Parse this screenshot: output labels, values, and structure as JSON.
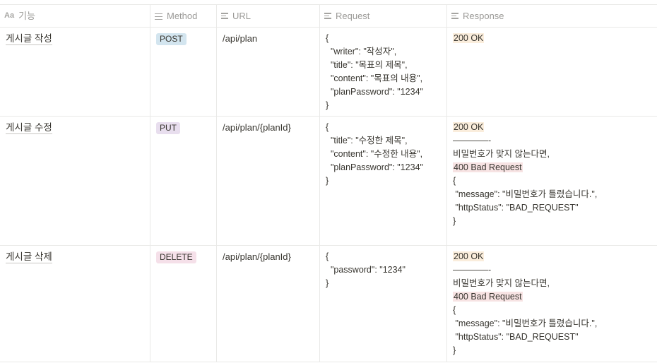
{
  "columns": {
    "feature": {
      "icon": "Aa",
      "label": "기능"
    },
    "method": {
      "icon": "list-icon",
      "label": "Method"
    },
    "url": {
      "icon": "text-icon",
      "label": "URL"
    },
    "request": {
      "icon": "text-icon",
      "label": "Request"
    },
    "response": {
      "icon": "text-icon",
      "label": "Response"
    }
  },
  "rows": [
    {
      "feature": "게시글 작성",
      "method": "POST",
      "url": "/api/plan",
      "request": "{\n  \"writer\": \"작성자\",\n  \"title\": \"목표의 제목\",\n  \"content\": \"목표의 내용\",\n  \"planPassword\": \"1234\"\n}",
      "response": {
        "status_ok": "200 OK"
      }
    },
    {
      "feature": "게시글 수정",
      "method": "PUT",
      "url": "/api/plan/{planId}",
      "request": "{\n  \"title\": \"수정한 제목\",\n  \"content\": \"수정한 내용\",\n  \"planPassword\": \"1234\"\n}",
      "response": {
        "status_ok": "200 OK",
        "divider": "————-",
        "condition": "비밀번호가 맞지 않는다면,",
        "status_bad": "400 Bad Request",
        "body": "{\n \"message\": \"비밀번호가 틀렸습니다.\",\n \"httpStatus\": \"BAD_REQUEST\"\n}"
      }
    },
    {
      "feature": "게시글 삭제",
      "method": "DELETE",
      "url": "/api/plan/{planId}",
      "request": "{\n  \"password\": \"1234\"\n}",
      "response": {
        "status_ok": "200 OK",
        "divider": "————-",
        "condition": "비밀번호가 맞지 않는다면,",
        "status_bad": "400 Bad Request",
        "body": "{\n \"message\": \"비밀번호가 틀렸습니다.\",\n \"httpStatus\": \"BAD_REQUEST\"\n}"
      }
    }
  ],
  "colors": {
    "post_tag": "#d3e5ef",
    "put_tag": "#e8deee",
    "delete_tag": "#f5e0e9",
    "ok_highlight": "#faeddc",
    "bad_highlight": "#f7e3e3"
  }
}
